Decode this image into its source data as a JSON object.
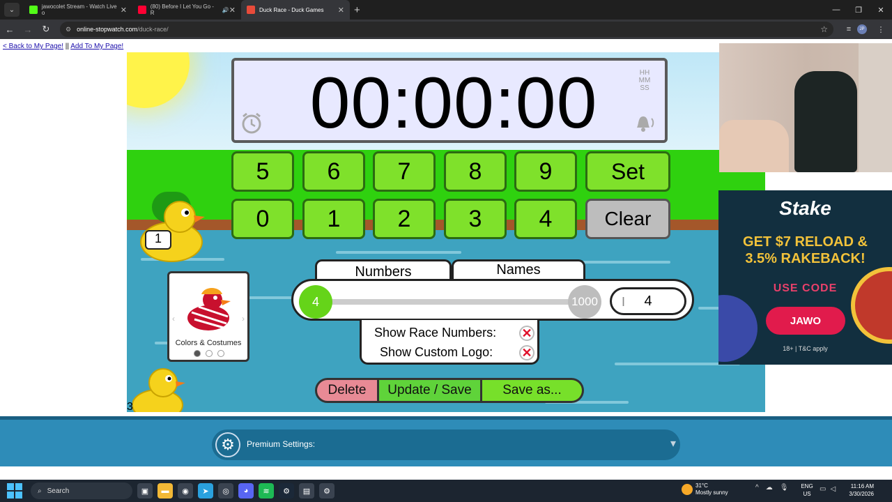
{
  "browser": {
    "tabs": [
      {
        "title": "jawocolet Stream - Watch Live o",
        "favicon_color": "#53fc18",
        "active": false
      },
      {
        "title": "(80) Before I Let You Go - R",
        "favicon_color": "#ff0033",
        "active": false
      },
      {
        "title": "Duck Race - Duck Games",
        "favicon_color": "#e84b3a",
        "active": true
      }
    ],
    "url_host": "online-stopwatch.com",
    "url_path": "/duck-race/",
    "profile_initials": "JP"
  },
  "page": {
    "back_link": "< Back to My Page!",
    "separator": "||",
    "add_link": "Add To My Page!"
  },
  "timer": {
    "display": "00:00:00",
    "format_hh": "HH",
    "format_mm": "MM",
    "format_ss": "SS"
  },
  "keypad": {
    "row1": [
      "5",
      "6",
      "7",
      "8",
      "9"
    ],
    "row2": [
      "0",
      "1",
      "2",
      "3",
      "4"
    ],
    "set_label": "Set",
    "clear_label": "Clear"
  },
  "ducks": {
    "duck1_number": "1",
    "duck3_number": "3"
  },
  "costume_card": {
    "label": "Colors & Costumes"
  },
  "settings": {
    "tab_numbers": "Numbers",
    "tab_names": "Names",
    "slider_min": "4",
    "slider_max": "1000",
    "duck_count": "4",
    "show_race_numbers": "Show Race Numbers:",
    "show_custom_logo": "Show Custom Logo:"
  },
  "actions": {
    "delete": "Delete",
    "update_save": "Update / Save",
    "save_as": "Save as..."
  },
  "ad": {
    "brand": "Stake",
    "headline_line1": "GET $7 RELOAD &",
    "headline_line2": "3.5% RAKEBACK!",
    "use_code": "USE CODE",
    "code": "JAWO",
    "fine_print": "18+ | T&C apply"
  },
  "premium": {
    "label": "Premium Settings:"
  },
  "taskbar": {
    "search": "Search",
    "temp": "31°C",
    "weather": "Mostly sunny",
    "lang1": "ENG",
    "lang2": "US",
    "time": "11:16 AM",
    "date": "3/30/2026"
  }
}
